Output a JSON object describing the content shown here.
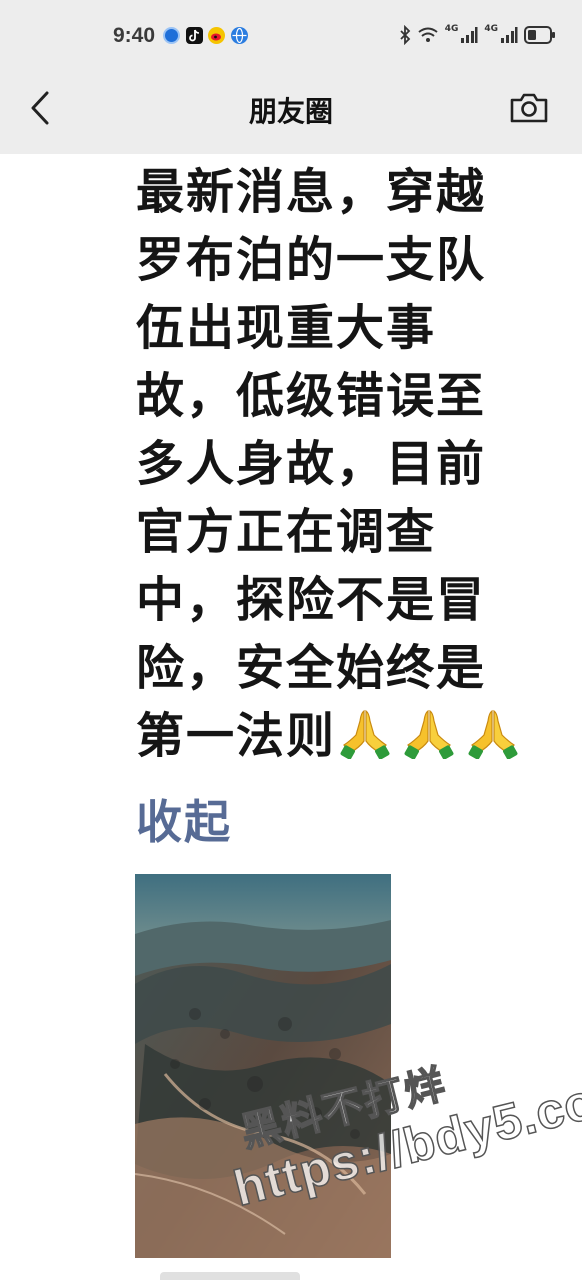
{
  "status_bar": {
    "time": "9:40",
    "app_icons": [
      "browser-icon",
      "tiktok-icon",
      "weibo-icon",
      "globe-icon"
    ],
    "network_labels": [
      "4G",
      "4G"
    ],
    "indicators": [
      "bluetooth-icon",
      "wifi-icon",
      "signal-icon",
      "signal-icon",
      "battery-icon"
    ]
  },
  "nav": {
    "title": "朋友圈",
    "back_icon": "chevron-left-icon",
    "camera_icon": "camera-icon"
  },
  "post": {
    "lines": [
      "最新消息，穿越",
      "罗布泊的一支队",
      "伍出现重大事",
      "故，低级错误至",
      "多人身故，目前",
      "官方正在调查",
      "中，探险不是冒",
      "险，安全始终是",
      "第一法则"
    ],
    "emojis": [
      "🙏",
      "🙏",
      "🙏"
    ],
    "collapse_label": "收起",
    "image_description_icon": "photo-thumbnail"
  },
  "watermark": {
    "line1": "黑料不打烊",
    "line2": "https://bdy5.co"
  },
  "colors": {
    "header_bg": "#ededed",
    "link_blue": "#576b95",
    "text": "#151515"
  }
}
